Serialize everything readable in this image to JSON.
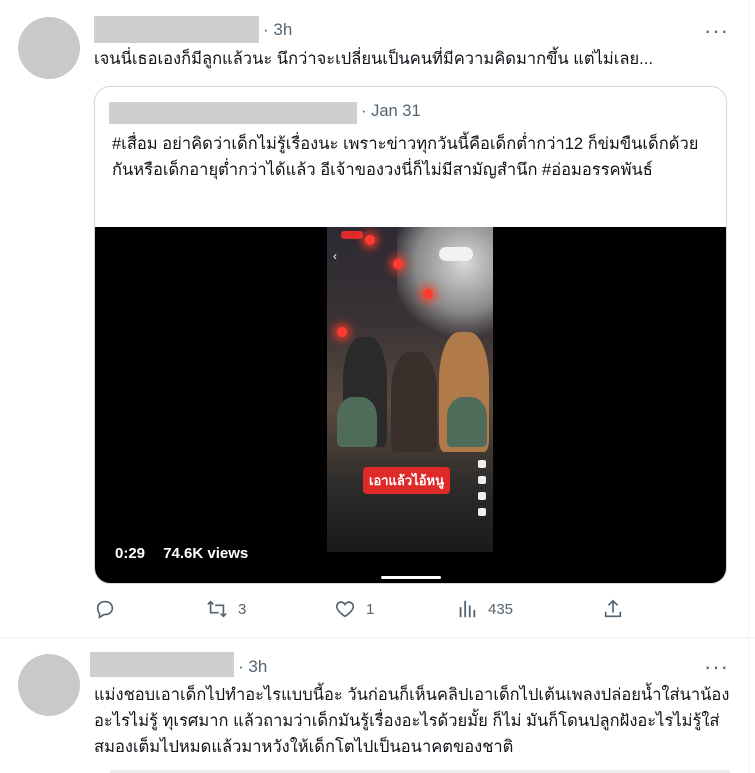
{
  "tweet1": {
    "time": "· 3h",
    "more": "···",
    "text": "เจนนี่เธอเองก็มีลูกแล้วนะ นึกว่าจะเปลี่ยนเป็นคนที่มีความคิดมากขึ้น แต่ไม่เลย...",
    "quote": {
      "date": "· Jan 31",
      "text": "#เสื่อม อย่าคิดว่าเด็กไม่รู้เรื่องนะ เพราะข่าวทุกวันนี้คือเด็กต่ำกว่า12 ก็ข่มขืนเด็กด้วยกันหรือเด็กอายุต่ำกว่าได้แล้ว อีเจ้าของวงนี่ก็ไม่มีสามัญสำนึก #อ่อมอรรคพันธ์",
      "video": {
        "duration": "0:29",
        "views": "74.6K views",
        "caption": "เอาแล้วไอ้หนู"
      }
    },
    "actions": {
      "reply_count": "",
      "retweet_count": "3",
      "like_count": "1",
      "views_count": "435"
    }
  },
  "tweet2": {
    "time": "· 3h",
    "more": "···",
    "text": "แม่งชอบเอาเด็กไปทำอะไรแบบนี้อะ วันก่อนก็เห็นคลิปเอาเด็กไปเต้นเพลงปล่อยน้ำใส่นาน้องอะไรไม่รู้ ทุเรศมาก แล้วถามว่าเด็กมันรู้เรื่องอะไรด้วยมั้ย ก็ไม่ มันก็โดนปลูกฝังอะไรไม่รู้ใส่สมองเต็มไปหมดแล้วมาหวังให้เด็กโตไปเป็นอนาคตของชาติ"
  },
  "colors": {
    "text": "#0f1419",
    "secondary": "#536471",
    "border": "#cfd9de",
    "redaction": "#cfcfcf"
  }
}
